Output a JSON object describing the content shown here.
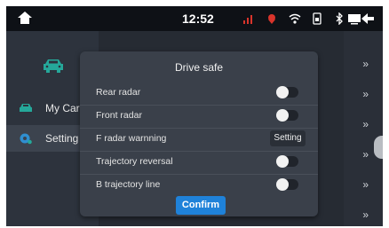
{
  "statusbar": {
    "time": "12:52",
    "icons": [
      "home-icon",
      "signal-icon",
      "location-icon",
      "wifi-icon",
      "sim-icon",
      "bluetooth-icon",
      "screen-icon",
      "back-icon"
    ]
  },
  "sidebar": {
    "items": [
      {
        "label": "My Car",
        "icon": "car-icon"
      },
      {
        "label": "Setting",
        "icon": "settings-icon",
        "active": true
      }
    ]
  },
  "dialog": {
    "title": "Drive safe",
    "rows": [
      {
        "label": "Rear radar",
        "control": "toggle",
        "on": false
      },
      {
        "label": "Front radar",
        "control": "toggle",
        "on": false
      },
      {
        "label": "F radar warnning",
        "control": "button",
        "button_label": "Setting"
      },
      {
        "label": "Trajectory reversal",
        "control": "toggle",
        "on": false
      },
      {
        "label": "B trajectory line",
        "control": "toggle",
        "on": false
      }
    ],
    "confirm_label": "Confirm"
  },
  "colors": {
    "accent": "#1f82d9",
    "status_red": "#d9342b"
  }
}
